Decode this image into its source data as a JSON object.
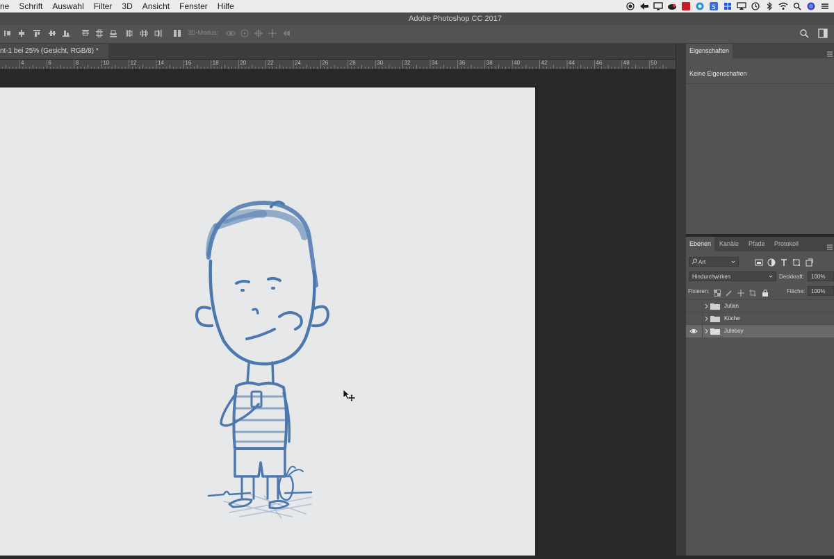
{
  "menubar": {
    "items": [
      "ne",
      "Schrift",
      "Auswahl",
      "Filter",
      "3D",
      "Ansicht",
      "Fenster",
      "Hilfe"
    ],
    "status_icons": [
      "record-icon",
      "screen-share-icon",
      "display-icon",
      "cloud-icon",
      "red-app-icon",
      "globe-icon",
      "s-app-icon",
      "windows-icon",
      "airplay-icon",
      "time-machine-icon",
      "bluetooth-icon",
      "wifi-icon",
      "spotlight-icon",
      "siri-icon",
      "menu-list-icon"
    ]
  },
  "app": {
    "title": "Adobe Photoshop CC 2017"
  },
  "optionsbar": {
    "mode_label": "3D-Modus:"
  },
  "document": {
    "tab_title": "nt-1 bei 25% (Gesicht, RGB/8) *"
  },
  "ruler": {
    "ticks": [
      "4",
      "6",
      "8",
      "10",
      "12",
      "14",
      "16",
      "18",
      "20",
      "22",
      "24",
      "26",
      "28",
      "30",
      "32",
      "34",
      "36",
      "38",
      "40",
      "42",
      "44",
      "46",
      "48",
      "50"
    ]
  },
  "properties": {
    "tab": "Eigenschaften",
    "empty_text": "Keine Eigenschaften"
  },
  "layers_panel": {
    "tabs": [
      "Ebenen",
      "Kanäle",
      "Pfade",
      "Protokoll"
    ],
    "filter_kind": "Art",
    "blend_mode": "Hindurchwirken",
    "opacity_label": "Deckkraft:",
    "opacity_value": "100%",
    "lock_label": "Fixieren:",
    "fill_label": "Fläche:",
    "fill_value": "100%",
    "layers": [
      {
        "name": "Julian",
        "visible": false,
        "selected": false
      },
      {
        "name": "Küche",
        "visible": false,
        "selected": false
      },
      {
        "name": "Juleboy",
        "visible": true,
        "selected": true
      }
    ]
  },
  "colors": {
    "canvas": "#e6e8ea",
    "sketch_blue": "#4d78ad",
    "panel": "#535353",
    "workspace": "#282828"
  }
}
